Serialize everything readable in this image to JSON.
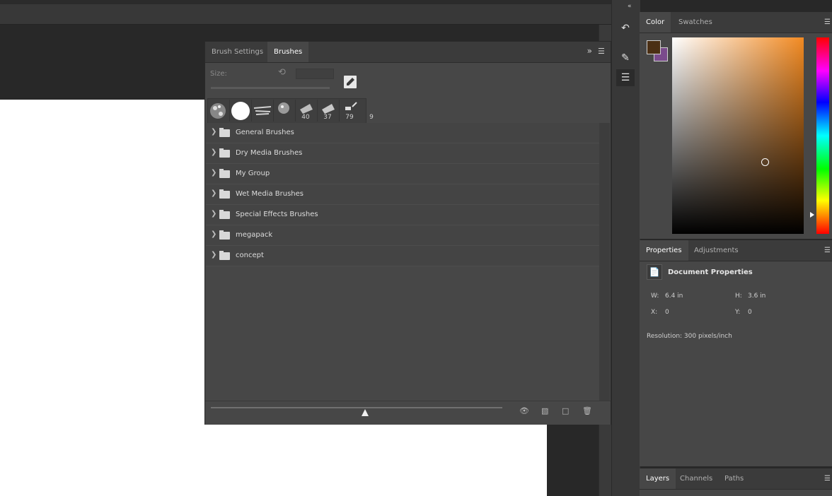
{
  "brushes_panel": {
    "tabs": [
      "Brush Settings",
      "Brushes"
    ],
    "active_tab": "Brushes",
    "size_label": "Size:",
    "size_value": "",
    "presets": [
      {
        "icon": "splatter-brush-icon",
        "number": ""
      },
      {
        "icon": "round-hard-brush-icon",
        "number": ""
      },
      {
        "icon": "scatter-brush-icon",
        "number": ""
      },
      {
        "icon": "splatter-brush-icon",
        "number": "40"
      },
      {
        "icon": "chalk-brush-icon",
        "number": "37"
      },
      {
        "icon": "chalk-brush-icon",
        "number": "79"
      },
      {
        "icon": "small-brush-icon",
        "number": "9"
      }
    ],
    "groups": [
      "General Brushes",
      "Dry Media Brushes",
      "My Group",
      "Wet Media Brushes",
      "Special Effects Brushes",
      "megapack",
      "concept"
    ],
    "footer_icons": [
      "toggle-visibility-icon",
      "new-group-icon",
      "new-brush-icon",
      "delete-icon"
    ]
  },
  "color_panel": {
    "tabs": [
      "Color",
      "Swatches"
    ],
    "active_tab": "Color",
    "foreground": "#4b2f14",
    "background": "#7a4b8c"
  },
  "properties_panel": {
    "tabs": [
      "Properties",
      "Adjustments"
    ],
    "active_tab": "Properties",
    "title": "Document Properties",
    "w_label": "W:",
    "w_value": "6.4 in",
    "h_label": "H:",
    "h_value": "3.6 in",
    "x_label": "X:",
    "x_value": "0",
    "y_label": "Y:",
    "y_value": "0",
    "resolution": "Resolution: 300 pixels/inch"
  },
  "layers_panel": {
    "tabs": [
      "Layers",
      "Channels",
      "Paths"
    ],
    "active_tab": "Layers"
  },
  "dock_icons": [
    "history-icon",
    "brush-presets-icon",
    "adjustments-icon"
  ]
}
